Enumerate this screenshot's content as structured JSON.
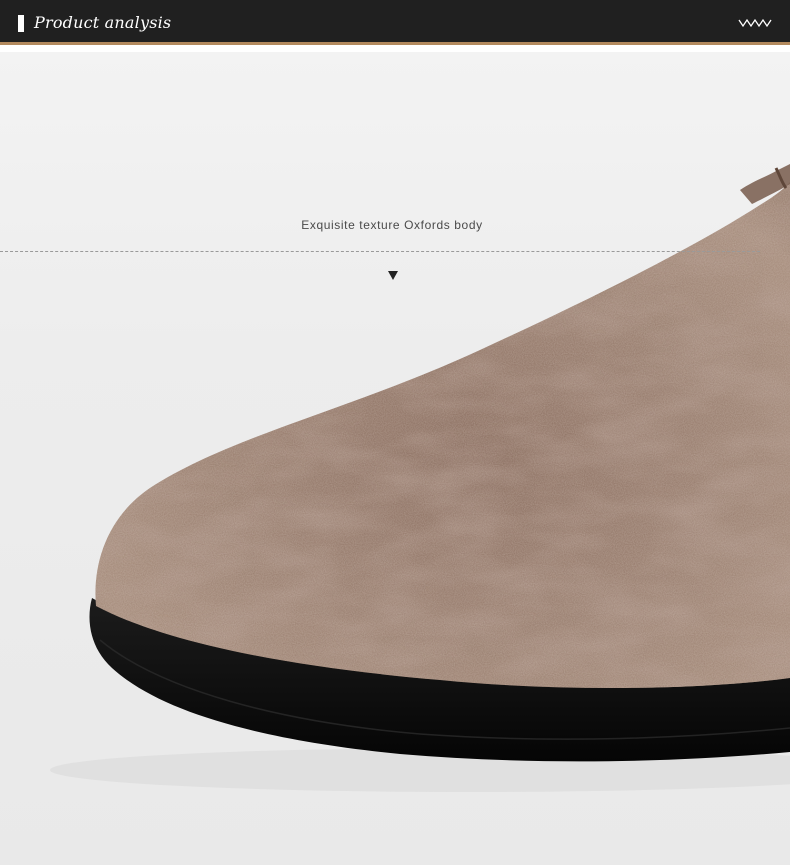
{
  "header": {
    "title": "Product analysis",
    "marker_color": "#ffffff",
    "background": "#202020",
    "accent_line_color": "#b38a5e",
    "right_icon": "chevron-down-icon"
  },
  "caption": {
    "text": "Exquisite texture Oxfords body",
    "pointer_icon": "triangle-down-icon"
  },
  "product_image": {
    "subject": "shoe-toe-closeup",
    "upper_color": "#8f7566",
    "sole_color": "#111111"
  }
}
